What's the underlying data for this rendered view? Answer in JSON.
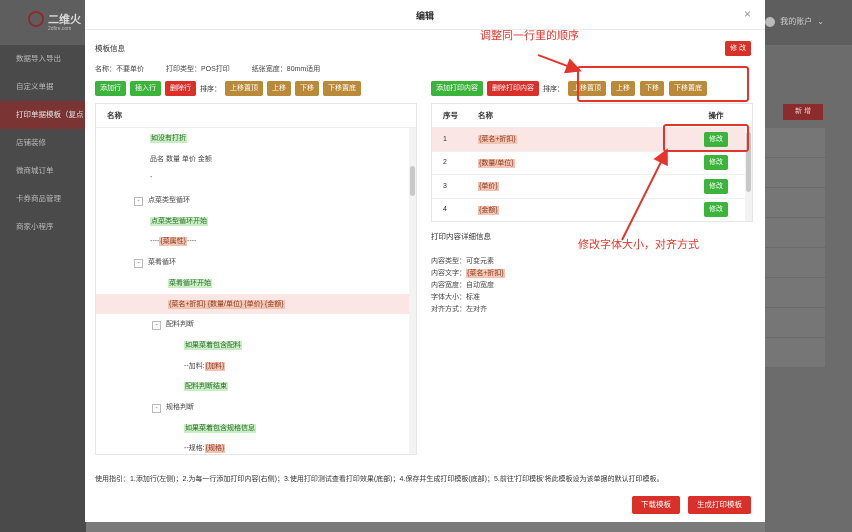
{
  "app": {
    "logo_name": "二维火",
    "logo_sub": "2dfire.com",
    "account_label": "我的账户"
  },
  "sidebar": {
    "items": [
      {
        "label": "数据导入导出"
      },
      {
        "label": "自定义单据"
      },
      {
        "label": "打印单据模板（复点"
      },
      {
        "label": "店铺装修"
      },
      {
        "label": "微商城订单"
      },
      {
        "label": "卡券商品管理"
      },
      {
        "label": "商家小程序"
      }
    ],
    "active_index": 2
  },
  "background": {
    "new_button": "新 增"
  },
  "modal": {
    "title": "编辑",
    "close": "×",
    "template_info_title": "模板信息",
    "edit_button": "修 改",
    "info": {
      "name": "名称：不要单价",
      "print_type": "打印类型：POS打印",
      "paper_width": "纸张宽度：80mm适用"
    },
    "left_toolbar": {
      "add_row": "添加行",
      "insert_row": "插入行",
      "delete_row": "删除行",
      "sort_label": "排序：",
      "move_top": "上移置顶",
      "move_up": "上移",
      "move_down": "下移",
      "move_bottom": "下移置底"
    },
    "right_toolbar": {
      "add_content": "添加打印内容",
      "delete_content": "删除打印内容",
      "sort_label": "排序：",
      "move_top": "上移置顶",
      "move_up": "上移",
      "move_down": "下移",
      "move_bottom": "下移置底"
    },
    "left_table_header": "名称",
    "tree": [
      {
        "text": "如没有打折",
        "style": "green",
        "indent": 1,
        "toggle": false
      },
      {
        "text": "品名 数量 单价 金额",
        "style": "plain",
        "indent": 1,
        "toggle": false
      },
      {
        "text": "-",
        "style": "plain",
        "indent": 1,
        "toggle": false
      },
      {
        "text": "点菜类型循环",
        "style": "plain",
        "indent": 0,
        "toggle": true
      },
      {
        "text": "点菜类型循环开始",
        "style": "green",
        "indent": 1,
        "toggle": false
      },
      {
        "text": "----{菜属性}----",
        "style": "mixed",
        "indent": 1,
        "toggle": false
      },
      {
        "text": "菜肴循环",
        "style": "plain",
        "indent": 1,
        "toggle": true
      },
      {
        "text": "菜肴循环开始",
        "style": "green",
        "indent": 2,
        "toggle": false
      },
      {
        "text": "{菜名+折扣} {数量/单位} {单价} {金额}",
        "style": "salmon",
        "indent": 2,
        "toggle": false,
        "highlight": true
      },
      {
        "text": "配料判断",
        "style": "plain",
        "indent": 2,
        "toggle": true
      },
      {
        "text": "如果菜着包含配料",
        "style": "green",
        "indent": 3,
        "toggle": false
      },
      {
        "text": "--加料:{加料}",
        "style": "mixed",
        "indent": 3,
        "toggle": false
      },
      {
        "text": "配料判断结束",
        "style": "green",
        "indent": 3,
        "toggle": false
      },
      {
        "text": "规格判断",
        "style": "plain",
        "indent": 2,
        "toggle": true
      },
      {
        "text": "如果菜着包含规格信息",
        "style": "green",
        "indent": 3,
        "toggle": false
      },
      {
        "text": "--规格:{规格}",
        "style": "mixed",
        "indent": 3,
        "toggle": false
      }
    ],
    "right_table": {
      "headers": {
        "no": "序号",
        "name": "名称",
        "op": "操作"
      },
      "rows": [
        {
          "no": "1",
          "name": "{菜名+折扣}",
          "op": "修改"
        },
        {
          "no": "2",
          "name": "{数量/单位}",
          "op": "修改"
        },
        {
          "no": "3",
          "name": "{单价}",
          "op": "修改"
        },
        {
          "no": "4",
          "name": "{金额}",
          "op": "修改"
        }
      ]
    },
    "detail": {
      "title": "打印内容详细信息",
      "content_type": "内容类型：可变元素",
      "content_text_label": "内容文字：",
      "content_text_value": "{菜名+折扣}",
      "content_width": "内容宽度：自动宽度",
      "font_size": "字体大小：标准",
      "alignment": "对齐方式：左对齐"
    },
    "guide": "使用指引：1.添加行(左侧)；2.为每一行添加打印内容(右侧)；3.使用打印测试查看打印效果(底部)；4.保存并生成打印模板(底部)；5.前往'打印模板'将此模板设为该单据的默认打印模板。",
    "footer": {
      "download": "下载模板",
      "generate": "生成打印模板"
    }
  },
  "annotations": {
    "top": "调整同一行里的顺序",
    "middle": "修改字体大小，对齐方式"
  },
  "colors": {
    "primary_red": "#d9302a",
    "green": "#3cb43c",
    "brown": "#b88a3a",
    "annotation_red": "#e4352c"
  }
}
